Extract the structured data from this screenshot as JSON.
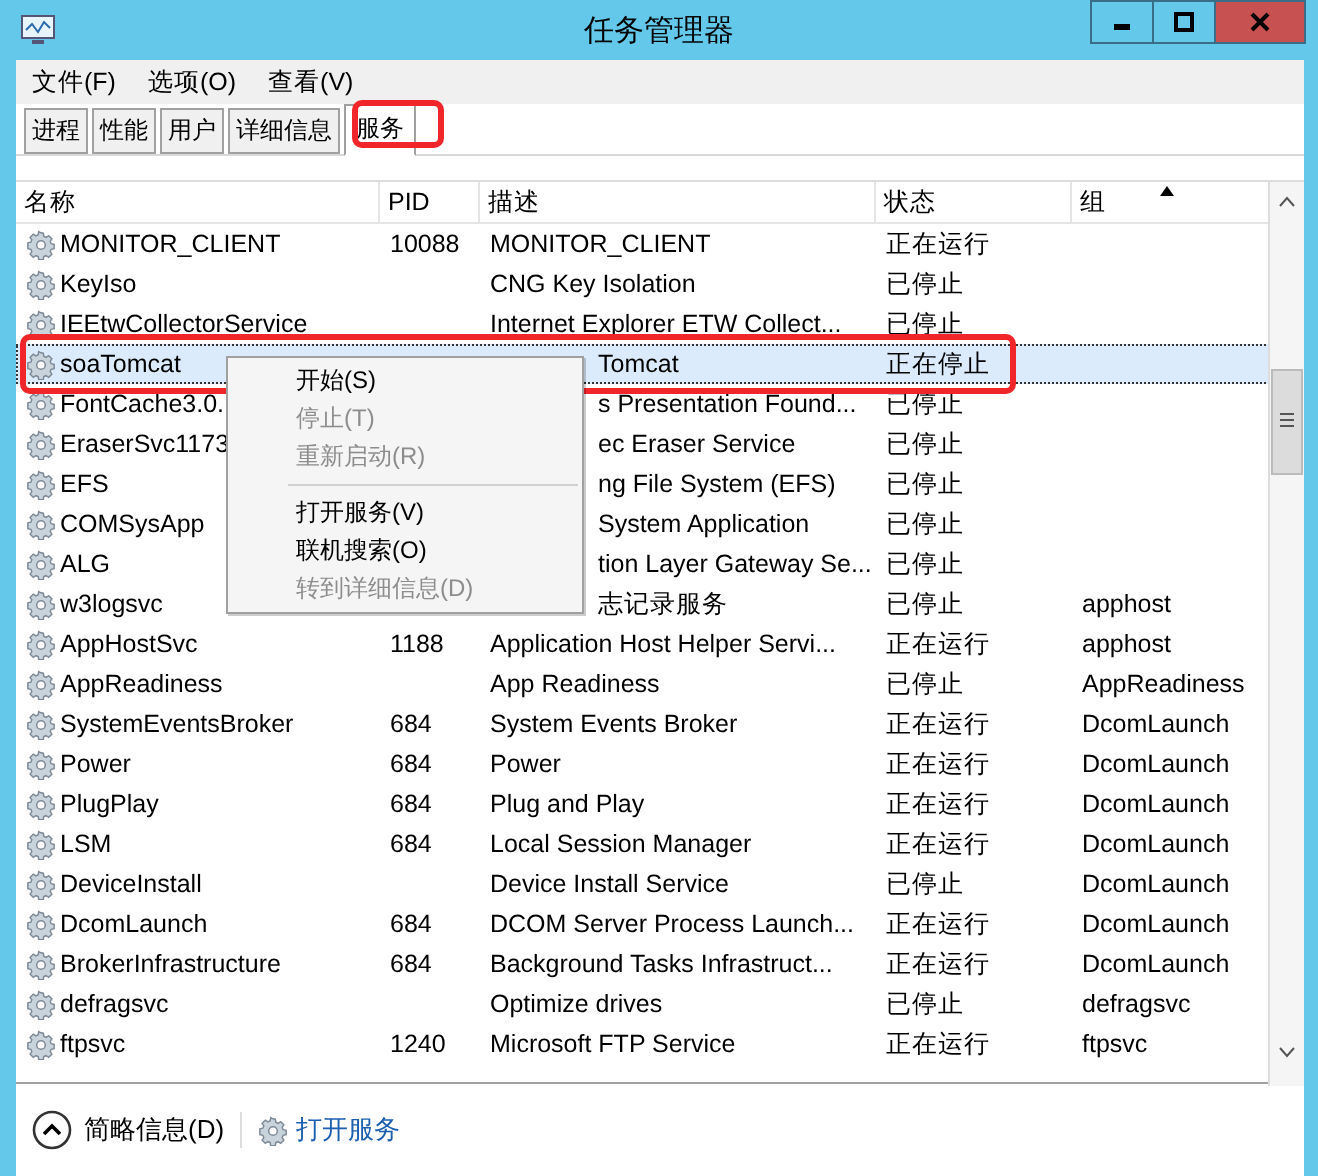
{
  "window": {
    "title": "任务管理器"
  },
  "menu_bar": [
    "文件(F)",
    "选项(O)",
    "查看(V)"
  ],
  "tabs": [
    {
      "label": "进程",
      "selected": false
    },
    {
      "label": "性能",
      "selected": false
    },
    {
      "label": "用户",
      "selected": false
    },
    {
      "label": "详细信息",
      "selected": false
    },
    {
      "label": "服务",
      "selected": true
    }
  ],
  "table": {
    "columns": [
      "名称",
      "PID",
      "描述",
      "状态",
      "组"
    ],
    "rows": [
      {
        "name": "MONITOR_CLIENT",
        "pid": "10088",
        "description": "MONITOR_CLIENT",
        "status": "正在运行",
        "group": "",
        "selected": false,
        "covered": false
      },
      {
        "name": "KeyIso",
        "pid": "",
        "description": "CNG Key Isolation",
        "status": "已停止",
        "group": "",
        "selected": false,
        "covered": false
      },
      {
        "name": "IEEtwCollectorService",
        "pid": "",
        "description": "Internet Explorer ETW Collect...",
        "status": "已停止",
        "group": "",
        "selected": false,
        "covered": false
      },
      {
        "name": "soaTomcat",
        "pid": "",
        "description": "Tomcat",
        "status": "正在停止",
        "group": "",
        "selected": true,
        "covered": true
      },
      {
        "name": "FontCache3.0.",
        "pid": "",
        "description": "s Presentation Found...",
        "status": "已停止",
        "group": "",
        "selected": false,
        "covered": true
      },
      {
        "name": "EraserSvc1173",
        "pid": "",
        "description": "ec Eraser Service",
        "status": "已停止",
        "group": "",
        "selected": false,
        "covered": true
      },
      {
        "name": "EFS",
        "pid": "",
        "description": "ng File System (EFS)",
        "status": "已停止",
        "group": "",
        "selected": false,
        "covered": true
      },
      {
        "name": "COMSysApp",
        "pid": "",
        "description": "System Application",
        "status": "已停止",
        "group": "",
        "selected": false,
        "covered": true
      },
      {
        "name": "ALG",
        "pid": "",
        "description": "tion Layer Gateway Se...",
        "status": "已停止",
        "group": "",
        "selected": false,
        "covered": true
      },
      {
        "name": "w3logsvc",
        "pid": "",
        "description": "志记录服务",
        "status": "已停止",
        "group": "apphost",
        "selected": false,
        "covered": true
      },
      {
        "name": "AppHostSvc",
        "pid": "1188",
        "description": "Application Host Helper Servi...",
        "status": "正在运行",
        "group": "apphost",
        "selected": false,
        "covered": false
      },
      {
        "name": "AppReadiness",
        "pid": "",
        "description": "App Readiness",
        "status": "已停止",
        "group": "AppReadiness",
        "selected": false,
        "covered": false
      },
      {
        "name": "SystemEventsBroker",
        "pid": "684",
        "description": "System Events Broker",
        "status": "正在运行",
        "group": "DcomLaunch",
        "selected": false,
        "covered": false
      },
      {
        "name": "Power",
        "pid": "684",
        "description": "Power",
        "status": "正在运行",
        "group": "DcomLaunch",
        "selected": false,
        "covered": false
      },
      {
        "name": "PlugPlay",
        "pid": "684",
        "description": "Plug and Play",
        "status": "正在运行",
        "group": "DcomLaunch",
        "selected": false,
        "covered": false
      },
      {
        "name": "LSM",
        "pid": "684",
        "description": "Local Session Manager",
        "status": "正在运行",
        "group": "DcomLaunch",
        "selected": false,
        "covered": false
      },
      {
        "name": "DeviceInstall",
        "pid": "",
        "description": "Device Install Service",
        "status": "已停止",
        "group": "DcomLaunch",
        "selected": false,
        "covered": false
      },
      {
        "name": "DcomLaunch",
        "pid": "684",
        "description": "DCOM Server Process Launch...",
        "status": "正在运行",
        "group": "DcomLaunch",
        "selected": false,
        "covered": false
      },
      {
        "name": "BrokerInfrastructure",
        "pid": "684",
        "description": "Background Tasks Infrastruct...",
        "status": "正在运行",
        "group": "DcomLaunch",
        "selected": false,
        "covered": false
      },
      {
        "name": "defragsvc",
        "pid": "",
        "description": "Optimize drives",
        "status": "已停止",
        "group": "defragsvc",
        "selected": false,
        "covered": false
      },
      {
        "name": "ftpsvc",
        "pid": "1240",
        "description": "Microsoft FTP Service",
        "status": "正在运行",
        "group": "ftpsvc",
        "selected": false,
        "covered": false
      }
    ]
  },
  "context_menu": [
    {
      "kind": "item",
      "label": "开始(S)",
      "disabled": false
    },
    {
      "kind": "item",
      "label": "停止(T)",
      "disabled": true
    },
    {
      "kind": "item",
      "label": "重新启动(R)",
      "disabled": true
    },
    {
      "kind": "separator"
    },
    {
      "kind": "item",
      "label": "打开服务(V)",
      "disabled": false
    },
    {
      "kind": "item",
      "label": "联机搜索(O)",
      "disabled": false
    },
    {
      "kind": "item",
      "label": "转到详细信息(D)",
      "disabled": true
    }
  ],
  "footer": {
    "fewer_details": "简略信息(D)",
    "open_services": "打开服务"
  }
}
